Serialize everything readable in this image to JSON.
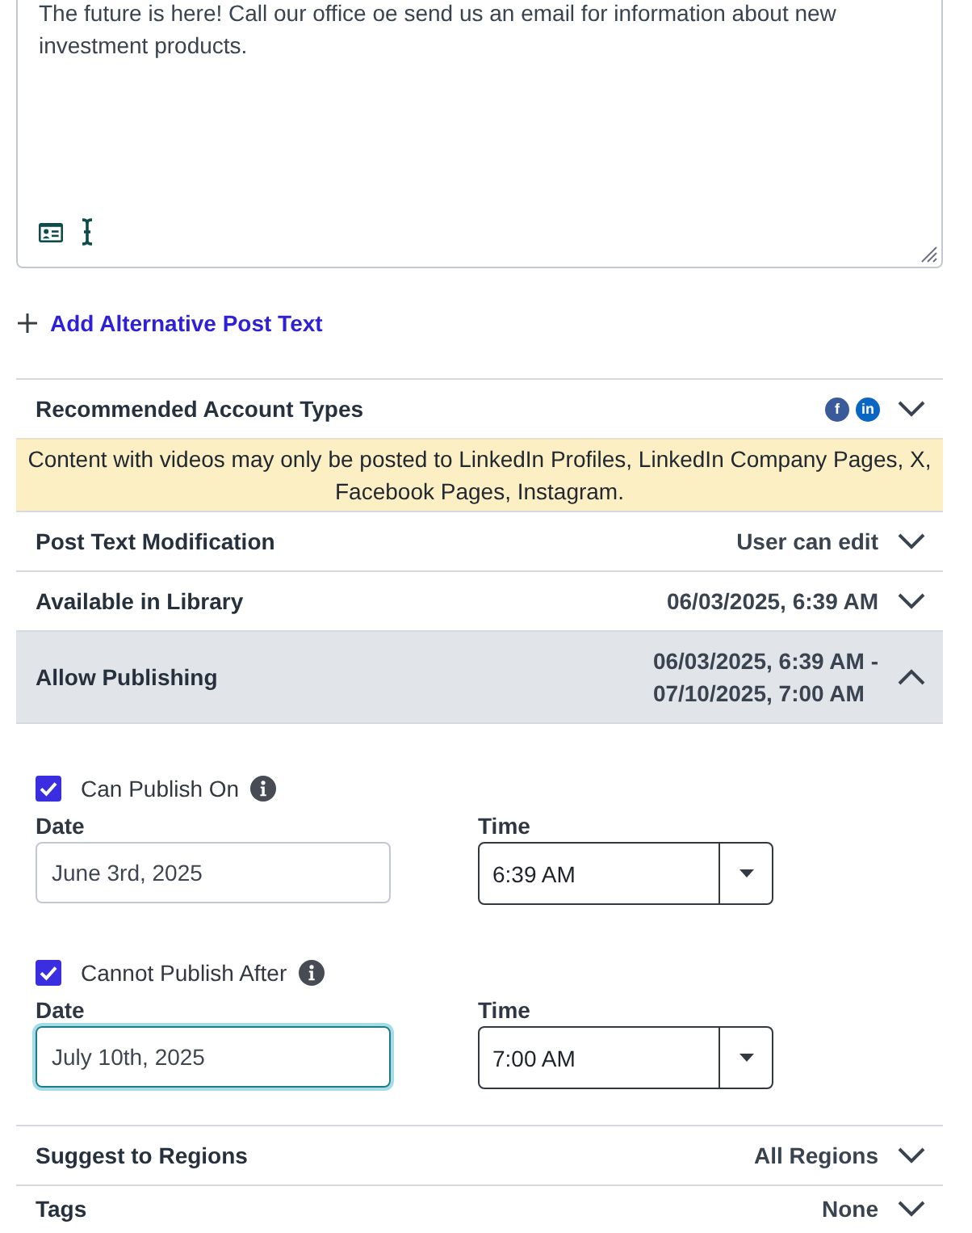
{
  "post_text": {
    "value": "The future is here! Call our office oe send us an email for information about new investment products."
  },
  "add_alternative_link": {
    "label": "Add Alternative Post Text"
  },
  "sections": [
    {
      "title": "Recommended Account Types",
      "expanded": false,
      "account_icons": [
        {
          "glyph": "f",
          "color": "#3b5a9a"
        },
        {
          "glyph": "in",
          "color": "#0a66c2"
        }
      ],
      "notice": "Content with videos may only be posted to LinkedIn Profiles, LinkedIn Company Pages, X, Facebook Pages, Instagram."
    },
    {
      "title": "Post Text Modification",
      "expanded": false,
      "value_lines": [
        "User can edit"
      ]
    },
    {
      "title": "Available in Library",
      "expanded": false,
      "value_lines": [
        "06/03/2025, 6:39 AM"
      ]
    },
    {
      "title": "Allow Publishing",
      "expanded": true,
      "value_lines": [
        "06/03/2025, 6:39 AM -",
        "07/10/2025, 7:00 AM"
      ],
      "options": [
        {
          "label": "Can Publish On",
          "checked": true,
          "date_label": "Date",
          "date": "June 3rd, 2025",
          "date_focused": false,
          "time_label": "Time",
          "time": "6:39 AM"
        },
        {
          "label": "Cannot Publish After",
          "checked": true,
          "date_label": "Date",
          "date": "July 10th, 2025",
          "date_focused": true,
          "time_label": "Time",
          "time": "7:00 AM"
        }
      ]
    },
    {
      "title": "Suggest to Regions",
      "expanded": false,
      "value_lines": [
        "All Regions"
      ]
    },
    {
      "title": "Tags",
      "expanded": false,
      "value_lines": [
        "None"
      ]
    }
  ]
}
